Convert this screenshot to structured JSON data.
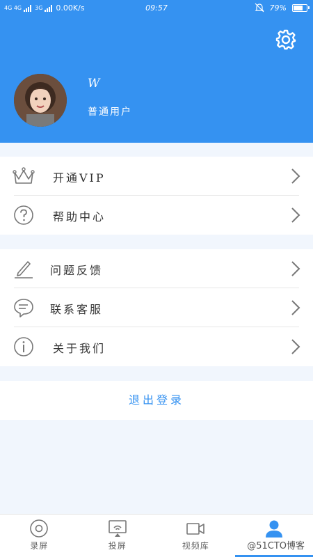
{
  "status_bar": {
    "network": "4G 4G",
    "signal_3g": "3G",
    "speed": "0.00K/s",
    "time": "09:57",
    "battery": "79%",
    "battery_level": 0.79
  },
  "header": {
    "user_name": "W",
    "user_type": "普通用户",
    "settings_icon": "gear-icon"
  },
  "menu_group_1": [
    {
      "label": "开通VIP",
      "icon": "crown-icon"
    },
    {
      "label": "帮助中心",
      "icon": "question-icon"
    }
  ],
  "menu_group_2": [
    {
      "label": "问题反馈",
      "icon": "pen-icon"
    },
    {
      "label": "联系客服",
      "icon": "chat-bubble-icon"
    },
    {
      "label": "关于我们",
      "icon": "info-icon"
    }
  ],
  "logout_label": "退出登录",
  "tabs": [
    {
      "label": "录屏",
      "icon": "record-icon"
    },
    {
      "label": "投屏",
      "icon": "cast-icon"
    },
    {
      "label": "视频库",
      "icon": "video-camera-icon"
    },
    {
      "label": "",
      "icon": "person-icon",
      "active": true
    }
  ],
  "watermark": "@51CTO博客",
  "colors": {
    "accent": "#3592f1",
    "background": "#f1f6fd"
  }
}
